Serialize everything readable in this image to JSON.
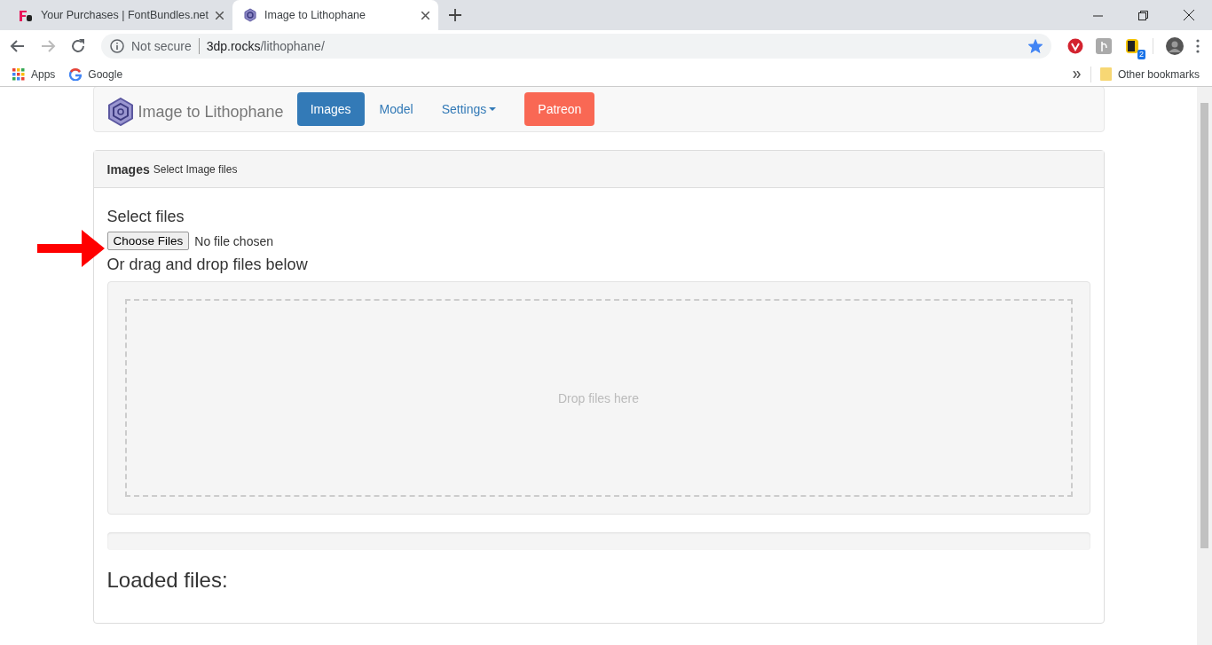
{
  "browser": {
    "tabs": [
      {
        "title": "Your Purchases | FontBundles.net",
        "kind": "fontbundles",
        "selected": false
      },
      {
        "title": "Image to Lithophane",
        "kind": "lithophane",
        "selected": true
      }
    ],
    "address": {
      "security": "Not secure",
      "host": "3dp.rocks",
      "path": "/lithophane/"
    },
    "bookmarked": true,
    "extension_badge": "2",
    "bookmarks": [
      {
        "label": "Apps",
        "kind": "apps"
      },
      {
        "label": "Google",
        "kind": "google"
      }
    ],
    "other_bookmarks": "Other bookmarks"
  },
  "navbar": {
    "brand": "Image to Lithophane",
    "items": [
      {
        "label": "Images",
        "kind": "link",
        "selected": true
      },
      {
        "label": "Model",
        "kind": "link",
        "selected": false
      },
      {
        "label": "Settings",
        "kind": "dropdown",
        "selected": false
      },
      {
        "label": "Patreon",
        "kind": "patreon",
        "selected": false
      }
    ]
  },
  "panel": {
    "title": "Images",
    "subtitle": "Select Image files",
    "select_label": "Select files",
    "file_button": "Choose Files",
    "file_status": "No file chosen",
    "drag_label": "Or drag and drop files below",
    "drop_hint": "Drop files here",
    "progress": {
      "level": 0
    },
    "loaded_heading": "Loaded files:"
  },
  "annotation": {
    "kind": "arrow"
  }
}
